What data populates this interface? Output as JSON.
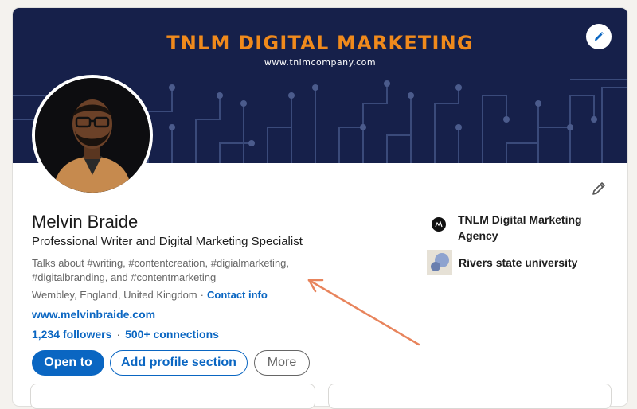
{
  "banner": {
    "title": "TNLM DIGITAL MARKETING",
    "url": "www.tnlmcompany.com",
    "background_color": "#16204a",
    "title_color": "#f08a1c"
  },
  "profile": {
    "name": "Melvin Braide",
    "headline": "Professional Writer and Digital Marketing Specialist",
    "talks_about": "Talks about #writing, #contentcreation, #digialmarketing, #digitalbranding, and #contentmarketing",
    "location": "Wembley, England, United Kingdom",
    "location_separator": "·",
    "contact_info_label": "Contact info",
    "website": "www.melvinbraide.com",
    "followers": "1,234 followers",
    "network_separator": "·",
    "connections": "500+ connections"
  },
  "actions": {
    "open_to": "Open to",
    "add_profile_section": "Add profile section",
    "more": "More"
  },
  "sidebar": {
    "company": "TNLM Digital Marketing Agency",
    "school": "Rivers state university"
  },
  "colors": {
    "accent": "#0a66c2",
    "annotation_arrow": "#e8845c",
    "page_background": "#f4f2ee"
  },
  "icons": {
    "banner_edit": "pencil-icon",
    "intro_edit": "pencil-icon"
  }
}
